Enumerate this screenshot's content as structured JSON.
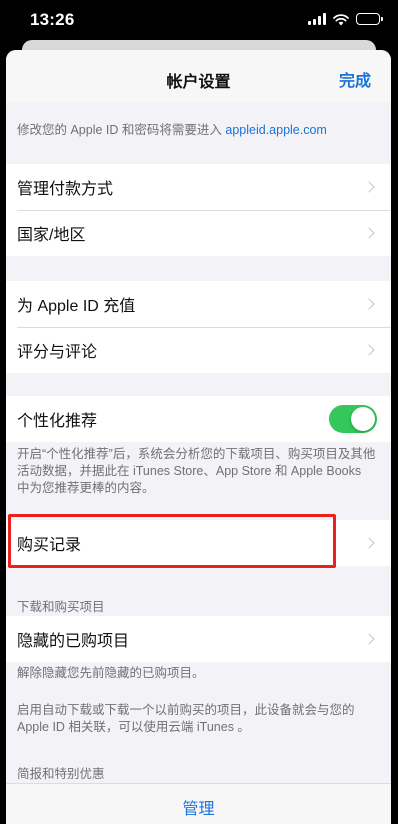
{
  "status_bar": {
    "time": "13:26"
  },
  "nav": {
    "title": "帐户设置",
    "done_label": "完成"
  },
  "apple_id_note": {
    "text": "修改您的 Apple ID 和密码将需要进入 ",
    "link": "appleid.apple.com"
  },
  "group1": {
    "items": [
      "管理付款方式",
      "国家/地区"
    ]
  },
  "group2": {
    "items": [
      "为 Apple ID 充值",
      "评分与评论"
    ]
  },
  "personalization": {
    "label": "个性化推荐",
    "enabled": true,
    "footnote": "开启“个性化推荐”后，系统会分析您的下载项目、购买项目及其他活动数据，并据此在 iTunes Store、App Store 和 Apple Books 中为您推荐更棒的内容。"
  },
  "purchase_history": {
    "label": "购买记录"
  },
  "downloads_section": {
    "header": "下载和购买项目",
    "hidden_label": "隐藏的已购项目",
    "hidden_footnote": "解除隐藏您先前隐藏的已购项目。",
    "auto_footnote": "启用自动下载或下载一个以前购买的项目，此设备就会与您的 Apple ID 相关联，可以使用云端 iTunes 。"
  },
  "newsletter_section": {
    "header": "简报和特别优惠"
  },
  "toolbar": {
    "manage_label": "管理"
  },
  "colors": {
    "accent": "#1a73d9",
    "toggle_on": "#34c759",
    "highlight": "#e8201e",
    "background": "#f2f2f7"
  }
}
